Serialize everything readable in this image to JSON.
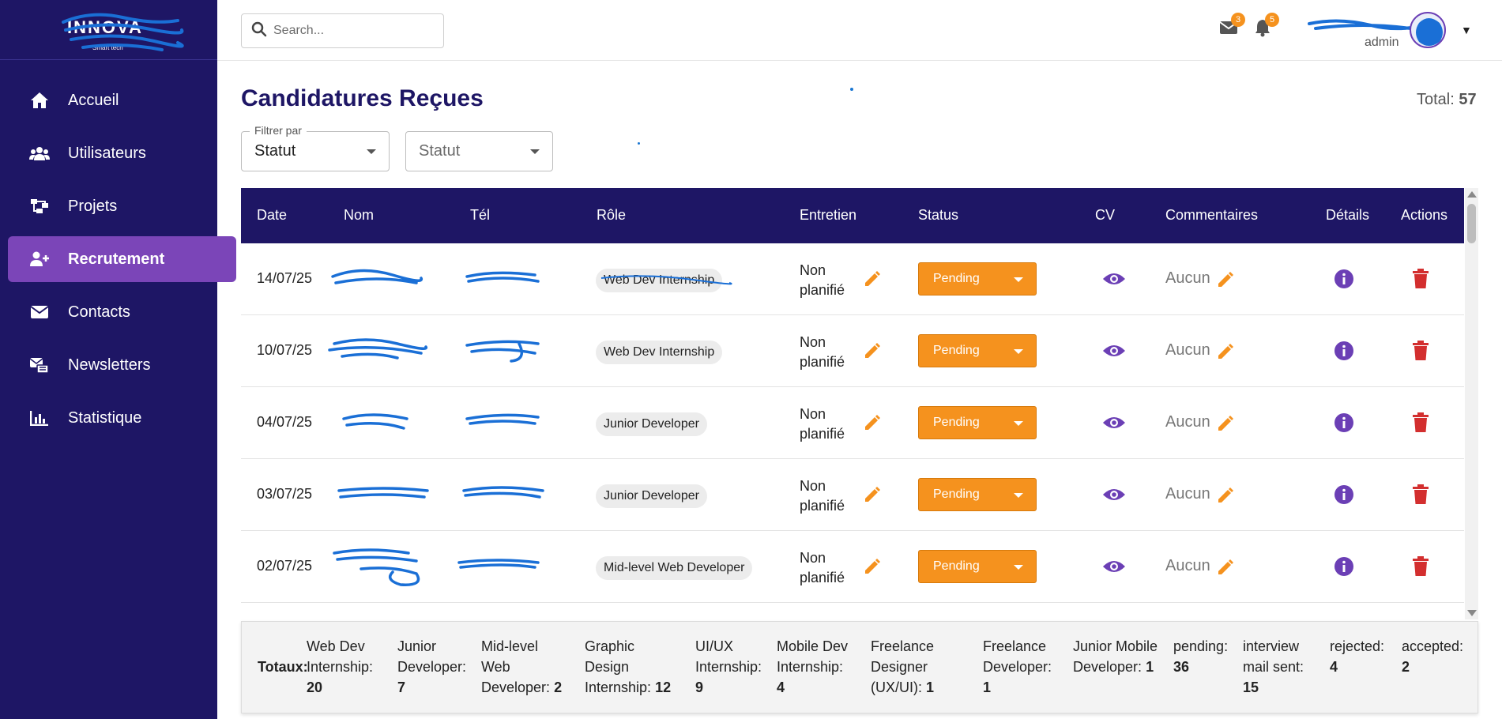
{
  "sidebar": {
    "logo_text": "INNOVA",
    "logo_tagline": "Smart tech",
    "items": [
      {
        "label": "Accueil",
        "icon": "home-icon",
        "active": false
      },
      {
        "label": "Utilisateurs",
        "icon": "users-icon",
        "active": false
      },
      {
        "label": "Projets",
        "icon": "project-icon",
        "active": false
      },
      {
        "label": "Recrutement",
        "icon": "user-plus-icon",
        "active": true
      },
      {
        "label": "Contacts",
        "icon": "envelope-icon",
        "active": false
      },
      {
        "label": "Newsletters",
        "icon": "newsletter-icon",
        "active": false
      },
      {
        "label": "Statistique",
        "icon": "chart-icon",
        "active": false
      }
    ]
  },
  "topbar": {
    "search_placeholder": "Search...",
    "mail_count": "3",
    "notification_count": "5",
    "user_role": "admin"
  },
  "page": {
    "title": "Candidatures Reçues",
    "total_label": "Total:",
    "total_value": "57"
  },
  "filters": {
    "filter_label": "Filtrer par",
    "filter_value": "Statut",
    "status_placeholder": "Statut"
  },
  "table": {
    "headers": [
      "Date",
      "Nom",
      "Tél",
      "Rôle",
      "Entretien",
      "Status",
      "CV",
      "Commentaires",
      "Détails",
      "Actions"
    ],
    "rows": [
      {
        "date": "14/07/25",
        "role": "Web Dev Internship",
        "entretien_1": "Non",
        "entretien_2": "planifié",
        "status": "Pending",
        "comment": "Aucun"
      },
      {
        "date": "10/07/25",
        "role": "Web Dev Internship",
        "entretien_1": "Non",
        "entretien_2": "planifié",
        "status": "Pending",
        "comment": "Aucun"
      },
      {
        "date": "04/07/25",
        "role": "Junior Developer",
        "entretien_1": "Non",
        "entretien_2": "planifié",
        "status": "Pending",
        "comment": "Aucun"
      },
      {
        "date": "03/07/25",
        "role": "Junior Developer",
        "entretien_1": "Non",
        "entretien_2": "planifié",
        "status": "Pending",
        "comment": "Aucun"
      },
      {
        "date": "02/07/25",
        "role": "Mid-level Web Developer",
        "entretien_1": "Non",
        "entretien_2": "planifié",
        "status": "Pending",
        "comment": "Aucun"
      }
    ]
  },
  "totals": {
    "label": "Totaux:",
    "items": [
      {
        "l1": "Web Dev",
        "l2": "Internship:",
        "l3": "",
        "value": "20"
      },
      {
        "l1": "Junior",
        "l2": "Developer:",
        "l3": "",
        "value": "7"
      },
      {
        "l1": "Mid-level",
        "l2": "Web",
        "l3": "Developer:",
        "value": "2"
      },
      {
        "l1": "Graphic",
        "l2": "Design",
        "l3": "Internship:",
        "value": "12"
      },
      {
        "l1": "UI/UX",
        "l2": "Internship:",
        "l3": "",
        "value": "9"
      },
      {
        "l1": "Mobile Dev",
        "l2": "Internship:",
        "l3": "",
        "value": "4"
      },
      {
        "l1": "Freelance",
        "l2": "Designer",
        "l3": "(UX/UI):",
        "value": "1"
      },
      {
        "l1": "Freelance",
        "l2": "Developer:",
        "l3": "",
        "value": "1"
      },
      {
        "l1": "Junior Mobile",
        "l2": "Developer:",
        "l3": "",
        "value": "1"
      },
      {
        "l1": "pending:",
        "l2": "",
        "l3": "",
        "value": "36"
      },
      {
        "l1": "interview",
        "l2": "mail sent:",
        "l3": "",
        "value": "15"
      },
      {
        "l1": "rejected:",
        "l2": "",
        "l3": "",
        "value": "4"
      },
      {
        "l1": "accepted:",
        "l2": "",
        "l3": "",
        "value": "2"
      }
    ]
  },
  "colors": {
    "sidebar_bg": "#1e1665",
    "active_item": "#7b45b8",
    "status_orange": "#f5921e",
    "icon_purple": "#6b3fb5",
    "trash_red": "#d32f2f",
    "redaction_blue": "#1a6fd6"
  }
}
